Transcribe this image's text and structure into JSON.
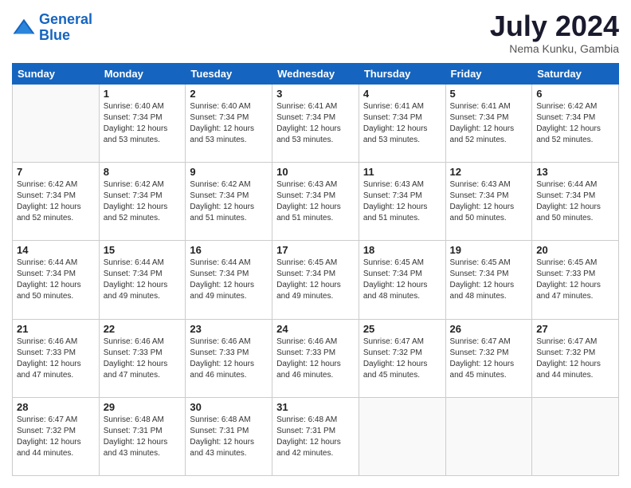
{
  "logo": {
    "line1": "General",
    "line2": "Blue"
  },
  "header": {
    "month": "July 2024",
    "location": "Nema Kunku, Gambia"
  },
  "weekdays": [
    "Sunday",
    "Monday",
    "Tuesday",
    "Wednesday",
    "Thursday",
    "Friday",
    "Saturday"
  ],
  "weeks": [
    [
      {
        "day": "",
        "sunrise": "",
        "sunset": "",
        "daylight": ""
      },
      {
        "day": "1",
        "sunrise": "Sunrise: 6:40 AM",
        "sunset": "Sunset: 7:34 PM",
        "daylight": "Daylight: 12 hours and 53 minutes."
      },
      {
        "day": "2",
        "sunrise": "Sunrise: 6:40 AM",
        "sunset": "Sunset: 7:34 PM",
        "daylight": "Daylight: 12 hours and 53 minutes."
      },
      {
        "day": "3",
        "sunrise": "Sunrise: 6:41 AM",
        "sunset": "Sunset: 7:34 PM",
        "daylight": "Daylight: 12 hours and 53 minutes."
      },
      {
        "day": "4",
        "sunrise": "Sunrise: 6:41 AM",
        "sunset": "Sunset: 7:34 PM",
        "daylight": "Daylight: 12 hours and 53 minutes."
      },
      {
        "day": "5",
        "sunrise": "Sunrise: 6:41 AM",
        "sunset": "Sunset: 7:34 PM",
        "daylight": "Daylight: 12 hours and 52 minutes."
      },
      {
        "day": "6",
        "sunrise": "Sunrise: 6:42 AM",
        "sunset": "Sunset: 7:34 PM",
        "daylight": "Daylight: 12 hours and 52 minutes."
      }
    ],
    [
      {
        "day": "7",
        "sunrise": "Sunrise: 6:42 AM",
        "sunset": "Sunset: 7:34 PM",
        "daylight": "Daylight: 12 hours and 52 minutes."
      },
      {
        "day": "8",
        "sunrise": "Sunrise: 6:42 AM",
        "sunset": "Sunset: 7:34 PM",
        "daylight": "Daylight: 12 hours and 52 minutes."
      },
      {
        "day": "9",
        "sunrise": "Sunrise: 6:42 AM",
        "sunset": "Sunset: 7:34 PM",
        "daylight": "Daylight: 12 hours and 51 minutes."
      },
      {
        "day": "10",
        "sunrise": "Sunrise: 6:43 AM",
        "sunset": "Sunset: 7:34 PM",
        "daylight": "Daylight: 12 hours and 51 minutes."
      },
      {
        "day": "11",
        "sunrise": "Sunrise: 6:43 AM",
        "sunset": "Sunset: 7:34 PM",
        "daylight": "Daylight: 12 hours and 51 minutes."
      },
      {
        "day": "12",
        "sunrise": "Sunrise: 6:43 AM",
        "sunset": "Sunset: 7:34 PM",
        "daylight": "Daylight: 12 hours and 50 minutes."
      },
      {
        "day": "13",
        "sunrise": "Sunrise: 6:44 AM",
        "sunset": "Sunset: 7:34 PM",
        "daylight": "Daylight: 12 hours and 50 minutes."
      }
    ],
    [
      {
        "day": "14",
        "sunrise": "Sunrise: 6:44 AM",
        "sunset": "Sunset: 7:34 PM",
        "daylight": "Daylight: 12 hours and 50 minutes."
      },
      {
        "day": "15",
        "sunrise": "Sunrise: 6:44 AM",
        "sunset": "Sunset: 7:34 PM",
        "daylight": "Daylight: 12 hours and 49 minutes."
      },
      {
        "day": "16",
        "sunrise": "Sunrise: 6:44 AM",
        "sunset": "Sunset: 7:34 PM",
        "daylight": "Daylight: 12 hours and 49 minutes."
      },
      {
        "day": "17",
        "sunrise": "Sunrise: 6:45 AM",
        "sunset": "Sunset: 7:34 PM",
        "daylight": "Daylight: 12 hours and 49 minutes."
      },
      {
        "day": "18",
        "sunrise": "Sunrise: 6:45 AM",
        "sunset": "Sunset: 7:34 PM",
        "daylight": "Daylight: 12 hours and 48 minutes."
      },
      {
        "day": "19",
        "sunrise": "Sunrise: 6:45 AM",
        "sunset": "Sunset: 7:34 PM",
        "daylight": "Daylight: 12 hours and 48 minutes."
      },
      {
        "day": "20",
        "sunrise": "Sunrise: 6:45 AM",
        "sunset": "Sunset: 7:33 PM",
        "daylight": "Daylight: 12 hours and 47 minutes."
      }
    ],
    [
      {
        "day": "21",
        "sunrise": "Sunrise: 6:46 AM",
        "sunset": "Sunset: 7:33 PM",
        "daylight": "Daylight: 12 hours and 47 minutes."
      },
      {
        "day": "22",
        "sunrise": "Sunrise: 6:46 AM",
        "sunset": "Sunset: 7:33 PM",
        "daylight": "Daylight: 12 hours and 47 minutes."
      },
      {
        "day": "23",
        "sunrise": "Sunrise: 6:46 AM",
        "sunset": "Sunset: 7:33 PM",
        "daylight": "Daylight: 12 hours and 46 minutes."
      },
      {
        "day": "24",
        "sunrise": "Sunrise: 6:46 AM",
        "sunset": "Sunset: 7:33 PM",
        "daylight": "Daylight: 12 hours and 46 minutes."
      },
      {
        "day": "25",
        "sunrise": "Sunrise: 6:47 AM",
        "sunset": "Sunset: 7:32 PM",
        "daylight": "Daylight: 12 hours and 45 minutes."
      },
      {
        "day": "26",
        "sunrise": "Sunrise: 6:47 AM",
        "sunset": "Sunset: 7:32 PM",
        "daylight": "Daylight: 12 hours and 45 minutes."
      },
      {
        "day": "27",
        "sunrise": "Sunrise: 6:47 AM",
        "sunset": "Sunset: 7:32 PM",
        "daylight": "Daylight: 12 hours and 44 minutes."
      }
    ],
    [
      {
        "day": "28",
        "sunrise": "Sunrise: 6:47 AM",
        "sunset": "Sunset: 7:32 PM",
        "daylight": "Daylight: 12 hours and 44 minutes."
      },
      {
        "day": "29",
        "sunrise": "Sunrise: 6:48 AM",
        "sunset": "Sunset: 7:31 PM",
        "daylight": "Daylight: 12 hours and 43 minutes."
      },
      {
        "day": "30",
        "sunrise": "Sunrise: 6:48 AM",
        "sunset": "Sunset: 7:31 PM",
        "daylight": "Daylight: 12 hours and 43 minutes."
      },
      {
        "day": "31",
        "sunrise": "Sunrise: 6:48 AM",
        "sunset": "Sunset: 7:31 PM",
        "daylight": "Daylight: 12 hours and 42 minutes."
      },
      {
        "day": "",
        "sunrise": "",
        "sunset": "",
        "daylight": ""
      },
      {
        "day": "",
        "sunrise": "",
        "sunset": "",
        "daylight": ""
      },
      {
        "day": "",
        "sunrise": "",
        "sunset": "",
        "daylight": ""
      }
    ]
  ]
}
